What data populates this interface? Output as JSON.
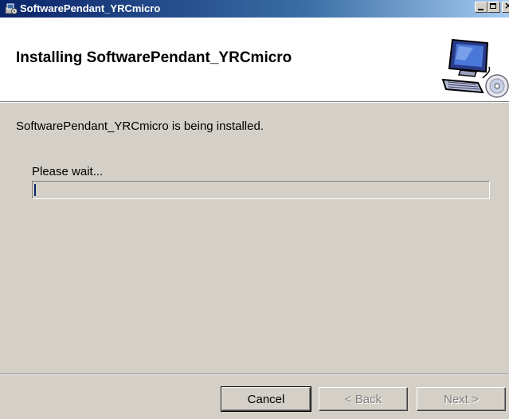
{
  "window": {
    "title": "SoftwarePendant_YRCmicro",
    "minimize_icon": "minimize-icon",
    "maximize_icon": "maximize-icon",
    "close_icon": "close-icon"
  },
  "banner": {
    "title": "Installing SoftwarePendant_YRCmicro",
    "graphic_icon": "computer-with-cd-icon"
  },
  "body": {
    "status": "SoftwarePendant_YRCmicro is being installed.",
    "wait_label": "Please wait...",
    "progress_fraction": 0.004
  },
  "buttons": {
    "cancel": "Cancel",
    "back": "< Back",
    "next": "Next >"
  },
  "colors": {
    "titlebar_start": "#0a246a",
    "titlebar_end": "#a6caf0",
    "dialog_bg": "#d4d0c8",
    "progress_fill": "#0a246a"
  }
}
